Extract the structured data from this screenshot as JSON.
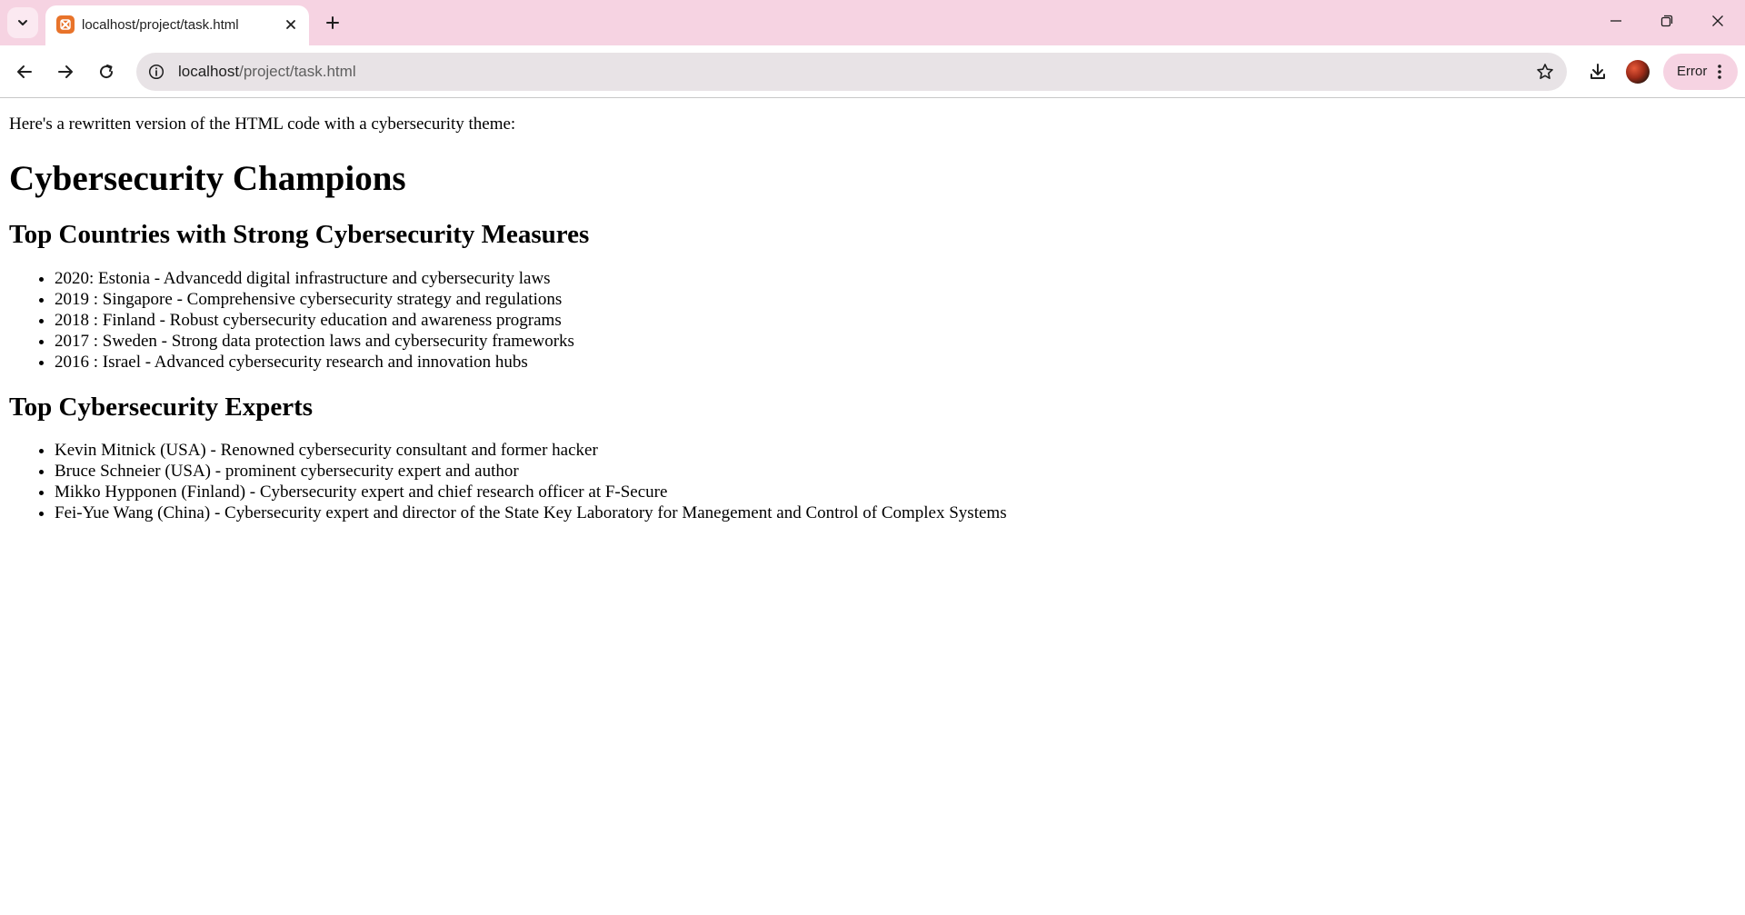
{
  "browser": {
    "tab": {
      "title": "localhost/project/task.html"
    },
    "url": {
      "host": "localhost",
      "path": "/project/task.html"
    },
    "profile_status": "Error"
  },
  "page": {
    "intro": "Here's a rewritten version of the HTML code with a cybersecurity theme:",
    "heading": "Cybersecurity Champions",
    "countries": {
      "heading": "Top Countries with Strong Cybersecurity Measures",
      "items": [
        "2020: Estonia - Advancedd digital infrastructure and cybersecurity laws",
        "2019 : Singapore - Comprehensive cybersecurity strategy and regulations",
        "2018 : Finland - Robust cybersecurity education and awareness programs",
        "2017 : Sweden - Strong data protection laws and cybersecurity frameworks",
        "2016 : Israel - Advanced cybersecurity research and innovation hubs"
      ]
    },
    "experts": {
      "heading": "Top Cybersecurity Experts",
      "items": [
        "Kevin Mitnick (USA) - Renowned cybersecurity consultant and former hacker",
        "Bruce Schneier (USA) - prominent cybersecurity expert and author",
        "Mikko Hypponen (Finland) - Cybersecurity expert and chief research officer at F-Secure",
        "Fei-Yue Wang (China) - Cybersecurity expert and director of the State Key Laboratory for Manegement and Control of Complex Systems"
      ]
    }
  }
}
